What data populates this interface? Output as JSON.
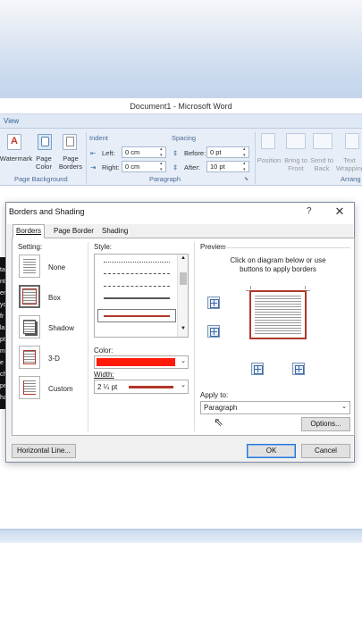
{
  "window": {
    "title": "Document1 - Microsoft Word",
    "tab": "View"
  },
  "ribbon": {
    "watermark": "Watermark",
    "page_color": "Page Color",
    "page_borders": "Page Borders",
    "page_background_group": "Page Background",
    "indent_header": "Indent",
    "left_label": "Left:",
    "left_value": "0 cm",
    "right_label": "Right:",
    "right_value": "0 cm",
    "spacing_header": "Spacing",
    "before_label": "Before:",
    "before_value": "0 pt",
    "after_label": "After:",
    "after_value": "10 pt",
    "paragraph_group": "Paragraph",
    "position": "Position",
    "bring_to_front": "Bring to Front",
    "send_to_back": "Send to Back",
    "text_wrapping": "Text Wrapping",
    "arrange_group": "Arrang"
  },
  "dialog": {
    "title": "Borders and Shading",
    "help": "?",
    "close": "✕",
    "tabs": [
      "Borders",
      "Page Border",
      "Shading"
    ],
    "setting_label": "Setting:",
    "settings": [
      "None",
      "Box",
      "Shadow",
      "3-D",
      "Custom"
    ],
    "style_label": "Style:",
    "color_label": "Color:",
    "color_value": "#ff1a0a",
    "width_label": "Width:",
    "width_value": "2 ¼ pt",
    "border_color": "#b0372a",
    "preview_label": "Preview",
    "preview_hint": "Click on diagram below or use buttons to apply borders",
    "apply_to_label": "Apply to:",
    "apply_to_value": "Paragraph",
    "options_button": "Options...",
    "horizontal_line_button": "Horizontal Line...",
    "ok_button": "OK",
    "cancel_button": "Cancel"
  },
  "doc_snippets": [
    "ta",
    "nt",
    "en",
    "",
    "yc",
    "fr",
    "la",
    "pt",
    "m",
    "e c",
    "ch",
    "pe",
    "ha"
  ]
}
